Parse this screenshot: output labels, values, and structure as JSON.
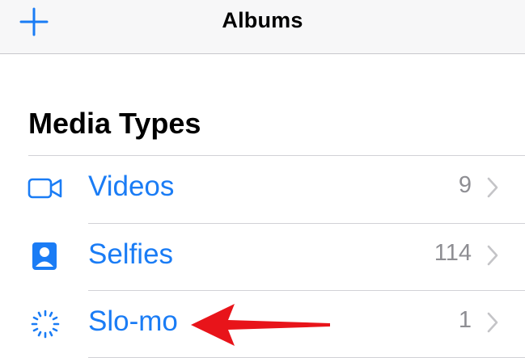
{
  "navbar": {
    "title": "Albums",
    "add_icon": "plus-icon"
  },
  "section": {
    "title": "Media Types"
  },
  "items": [
    {
      "label": "Videos",
      "count": "9",
      "icon": "video-camera-icon"
    },
    {
      "label": "Selfies",
      "count": "114",
      "icon": "portrait-icon"
    },
    {
      "label": "Slo-mo",
      "count": "1",
      "icon": "slo-mo-icon"
    }
  ],
  "colors": {
    "accent": "#1a7cf5",
    "count": "#8e8e93",
    "annotation_arrow": "#e8141a"
  }
}
